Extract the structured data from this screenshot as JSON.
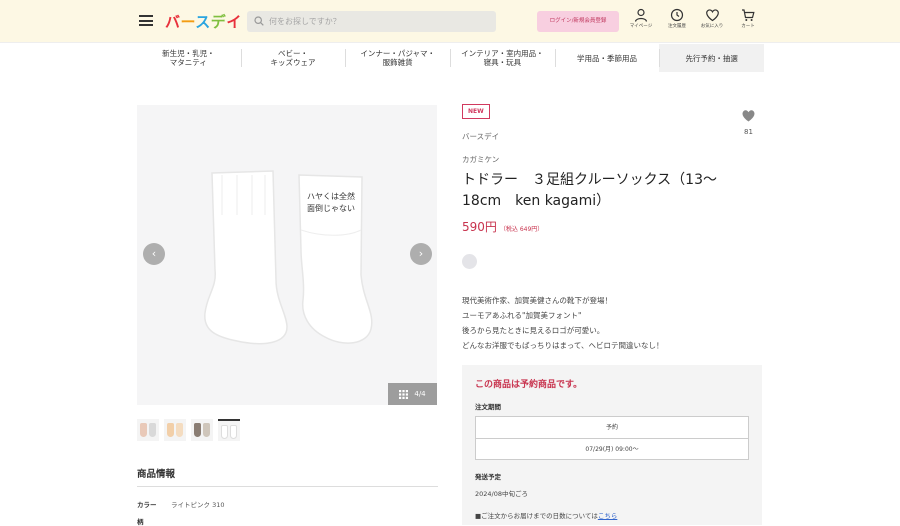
{
  "header": {
    "logo": [
      "バ",
      "ー",
      "ス",
      "デ",
      "イ"
    ],
    "search_placeholder": "何をお探しですか？",
    "login_label": "ログイン/新規会員登録",
    "icons": [
      {
        "name": "mypage",
        "label": "マイページ"
      },
      {
        "name": "history",
        "label": "注文履歴"
      },
      {
        "name": "favorites",
        "label": "お気に入り"
      },
      {
        "name": "cart",
        "label": "カート"
      }
    ]
  },
  "categories": [
    {
      "line1": "新生児・乳児・",
      "line2": "マタニティ"
    },
    {
      "line1": "ベビー・",
      "line2": "キッズウェア"
    },
    {
      "line1": "インナー・パジャマ・",
      "line2": "服飾雑貨"
    },
    {
      "line1": "インテリア・室内用品・",
      "line2": "寝具・玩具"
    },
    {
      "line1": "学用品・季節用品",
      "line2": ""
    },
    {
      "line1": "先行予約・抽選",
      "line2": ""
    }
  ],
  "gallery": {
    "counter": "4/4",
    "sock_text_line1": "ハヤくは全然",
    "sock_text_line2": "面倒じゃない",
    "thumb_colors": [
      [
        "#e9c9b8",
        "#d9d9d9"
      ],
      [
        "#f2cfa8",
        "#f4dcc0"
      ],
      [
        "#8a7d73",
        "#cfc6bb"
      ],
      [
        "#ffffff",
        "#ffffff"
      ]
    ]
  },
  "product": {
    "badge": "NEW",
    "brand": "バースデイ",
    "favorite_count": "81",
    "maker": "カガミケン",
    "title": "トドラー　３足組クルーソックス（13〜18cm　ken kagami）",
    "price": "590円",
    "price_tax": "（税込 649円）",
    "description": [
      "現代美術作家、加賀美健さんの靴下が登場！",
      "ユーモアあふれる\"加賀美フォント\"",
      "後ろから見たときに見えるロゴが可愛い。",
      "どんなお洋服でもばっちりはまって、ヘビロテ間違いなし！"
    ],
    "preorder": {
      "title": "この商品は予約商品です。",
      "period_label": "注文期間",
      "period_type": "予約",
      "period_value": "07/29(月) 09:00〜",
      "ship_label": "発送予定",
      "ship_value": "2024/08中旬ごろ",
      "note": "■ご注文からお届けまでの日数については",
      "note_link": "こちら"
    }
  },
  "spec": {
    "heading": "商品情報",
    "color_label": "カラー",
    "color_value": "ライトピンク 310",
    "next_label": "柄"
  },
  "colors": {
    "accent": "#c8334e",
    "header_bg": "#fdf8e4",
    "login_bg": "#f8cfe0"
  }
}
